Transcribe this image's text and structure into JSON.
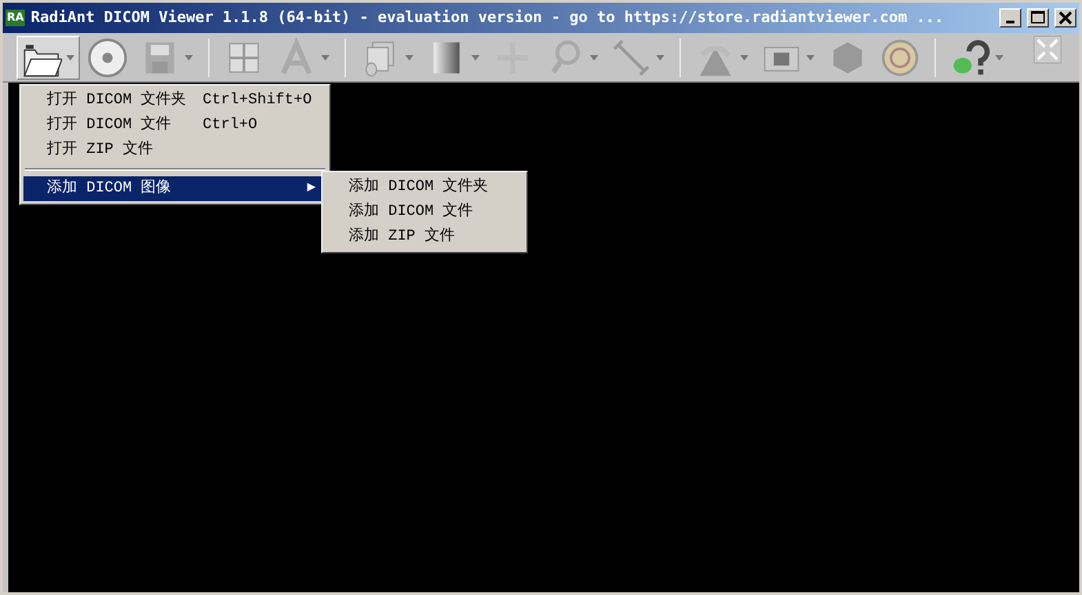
{
  "window": {
    "icon_text": "RA",
    "title": "RadiAnt DICOM Viewer 1.1.8 (64-bit) - evaluation version - go to https://store.radiantviewer.com ..."
  },
  "toolbar": [
    {
      "dropdown": true,
      "pressed": true
    },
    {
      "dropdown": false,
      "pressed": false
    },
    {
      "dropdown": true,
      "pressed": false
    },
    {
      "kind": "separator"
    },
    {
      "dropdown": false,
      "pressed": false
    },
    {
      "dropdown": true,
      "pressed": false
    },
    {
      "kind": "separator"
    },
    {
      "dropdown": true,
      "pressed": false
    },
    {
      "dropdown": true,
      "pressed": false
    },
    {
      "dropdown": false,
      "pressed": false
    },
    {
      "dropdown": true,
      "pressed": false
    },
    {
      "dropdown": true,
      "pressed": false
    },
    {
      "kind": "separator"
    },
    {
      "dropdown": true,
      "pressed": false
    },
    {
      "dropdown": true,
      "pressed": false
    },
    {
      "dropdown": false,
      "pressed": false
    },
    {
      "dropdown": false,
      "pressed": false
    },
    {
      "kind": "separator"
    },
    {
      "dropdown": true,
      "pressed": false
    }
  ],
  "menu": [
    {
      "kind": "item",
      "label": "打开 DICOM 文件夹",
      "shortcut": "Ctrl+Shift+O",
      "selected": false
    },
    {
      "kind": "item",
      "label": "打开 DICOM 文件",
      "shortcut": "Ctrl+O",
      "selected": false
    },
    {
      "kind": "item",
      "label": "打开 ZIP 文件",
      "selected": false
    },
    {
      "kind": "separator"
    },
    {
      "kind": "submenu",
      "label": "添加 DICOM 图像",
      "selected": true,
      "arrow": "▶"
    }
  ],
  "submenu": [
    {
      "label": "添加 DICOM 文件夹",
      "selected": false
    },
    {
      "label": "添加 DICOM 文件",
      "selected": false
    },
    {
      "label": "添加 ZIP 文件",
      "selected": false
    }
  ]
}
